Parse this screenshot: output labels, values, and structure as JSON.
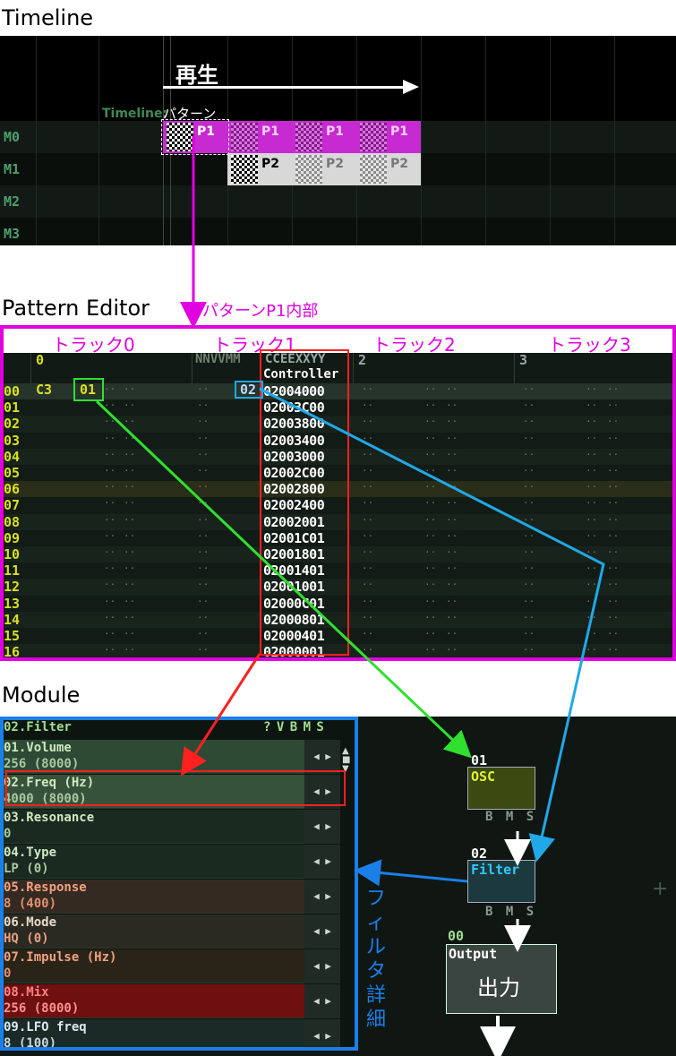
{
  "sections": {
    "timeline_title": "Timeline",
    "pattern_title": "Pattern Editor",
    "module_title": "Module"
  },
  "timeline": {
    "play_annotation": "再生",
    "marker_label": "Timeline:",
    "marker_pattern": "パターン",
    "tracks": [
      "M0",
      "M1",
      "M2",
      "M3"
    ],
    "clips_row0": [
      "P1",
      "P1",
      "P1",
      "P1"
    ],
    "clips_row1": [
      "P2",
      "P2",
      "P2"
    ]
  },
  "pattern_editor": {
    "annotation": "パターンP1内部",
    "track_labels": [
      "トラック0",
      "トラック1",
      "トラック2",
      "トラック3"
    ],
    "col_header": [
      "0",
      "NNVVMM",
      "CCEEXXYY",
      "2",
      "3"
    ],
    "controller_label": "Controller",
    "first_row": {
      "note": "C3",
      "instrument": "01",
      "controller_prefix": "02"
    },
    "row_numbers": [
      "00",
      "01",
      "02",
      "03",
      "04",
      "05",
      "06",
      "07",
      "08",
      "09",
      "10",
      "11",
      "12",
      "13",
      "14",
      "15",
      "16"
    ],
    "controller_values": [
      "02004000",
      "02003C00",
      "02003800",
      "02003400",
      "02003000",
      "02002C00",
      "02002800",
      "02002400",
      "02002001",
      "02001C01",
      "02001801",
      "02001401",
      "02001001",
      "02000C01",
      "02000801",
      "02000401",
      "02000001"
    ]
  },
  "module": {
    "header_title": "02.Filter",
    "header_flags": "? V B M S",
    "params": [
      {
        "name": "01.Volume",
        "value": "256 (8000)"
      },
      {
        "name": "02.Freq (Hz)",
        "value": "4000 (8000)"
      },
      {
        "name": "03.Resonance",
        "value": "0"
      },
      {
        "name": "04.Type",
        "value": "LP (0)"
      },
      {
        "name": "05.Response",
        "value": "8 (400)"
      },
      {
        "name": "06.Mode",
        "value": "HQ (0)"
      },
      {
        "name": "07.Impulse (Hz)",
        "value": "0"
      },
      {
        "name": "08.Mix",
        "value": "256 (8000)"
      },
      {
        "name": "09.LFO freq",
        "value": "8 (100)"
      }
    ],
    "filter_detail_annotation": "フィルタ詳細",
    "nodes": {
      "osc": {
        "id": "01",
        "name": "OSC"
      },
      "filter": {
        "id": "02",
        "name": "Filter"
      },
      "output": {
        "id": "00",
        "name": "Output",
        "caption": "出力"
      },
      "bms": "B M S"
    }
  },
  "colors": {
    "magenta": "#e000e0",
    "blue": "#1a80e8",
    "red": "#ff2020",
    "green": "#30e030",
    "cyan": "#20a8e8"
  }
}
